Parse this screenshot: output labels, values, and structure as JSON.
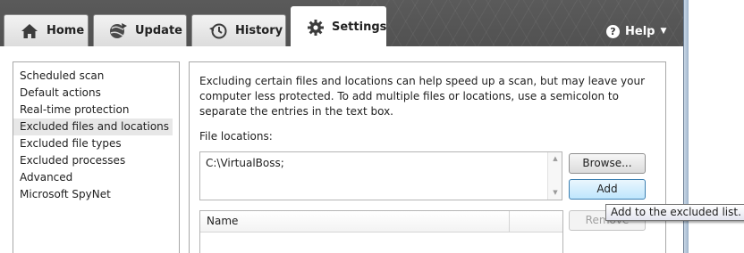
{
  "tabs": [
    {
      "label": "Home",
      "icon": "home-icon"
    },
    {
      "label": "Update",
      "icon": "update-globe-icon"
    },
    {
      "label": "History",
      "icon": "history-clock-icon"
    },
    {
      "label": "Settings",
      "icon": "gear-icon",
      "active": true
    }
  ],
  "help": {
    "label": "Help",
    "icon": "help-icon",
    "arrow": "chevron-down-icon"
  },
  "sidebar": {
    "items": [
      {
        "label": "Scheduled scan"
      },
      {
        "label": "Default actions"
      },
      {
        "label": "Real-time protection"
      },
      {
        "label": "Excluded files and locations",
        "selected": true
      },
      {
        "label": "Excluded file types"
      },
      {
        "label": "Excluded processes"
      },
      {
        "label": "Advanced"
      },
      {
        "label": "Microsoft SpyNet"
      }
    ]
  },
  "main": {
    "description": "Excluding certain files and locations can help speed up a scan, but may leave your computer less protected. To add multiple files or locations, use a semicolon to separate the entries in the text box.",
    "file_locations_label": "File locations:",
    "file_locations_value": "C:\\VirtualBoss;",
    "browse_label": "Browse...",
    "add_label": "Add",
    "remove_label": "Remove",
    "list_header_name": "Name"
  },
  "tooltip": {
    "text": "Add to the excluded list."
  },
  "colors": {
    "accent": "#3c7fb1",
    "selection": "#e7e7e7",
    "window_dark": "#4a4a4a"
  }
}
